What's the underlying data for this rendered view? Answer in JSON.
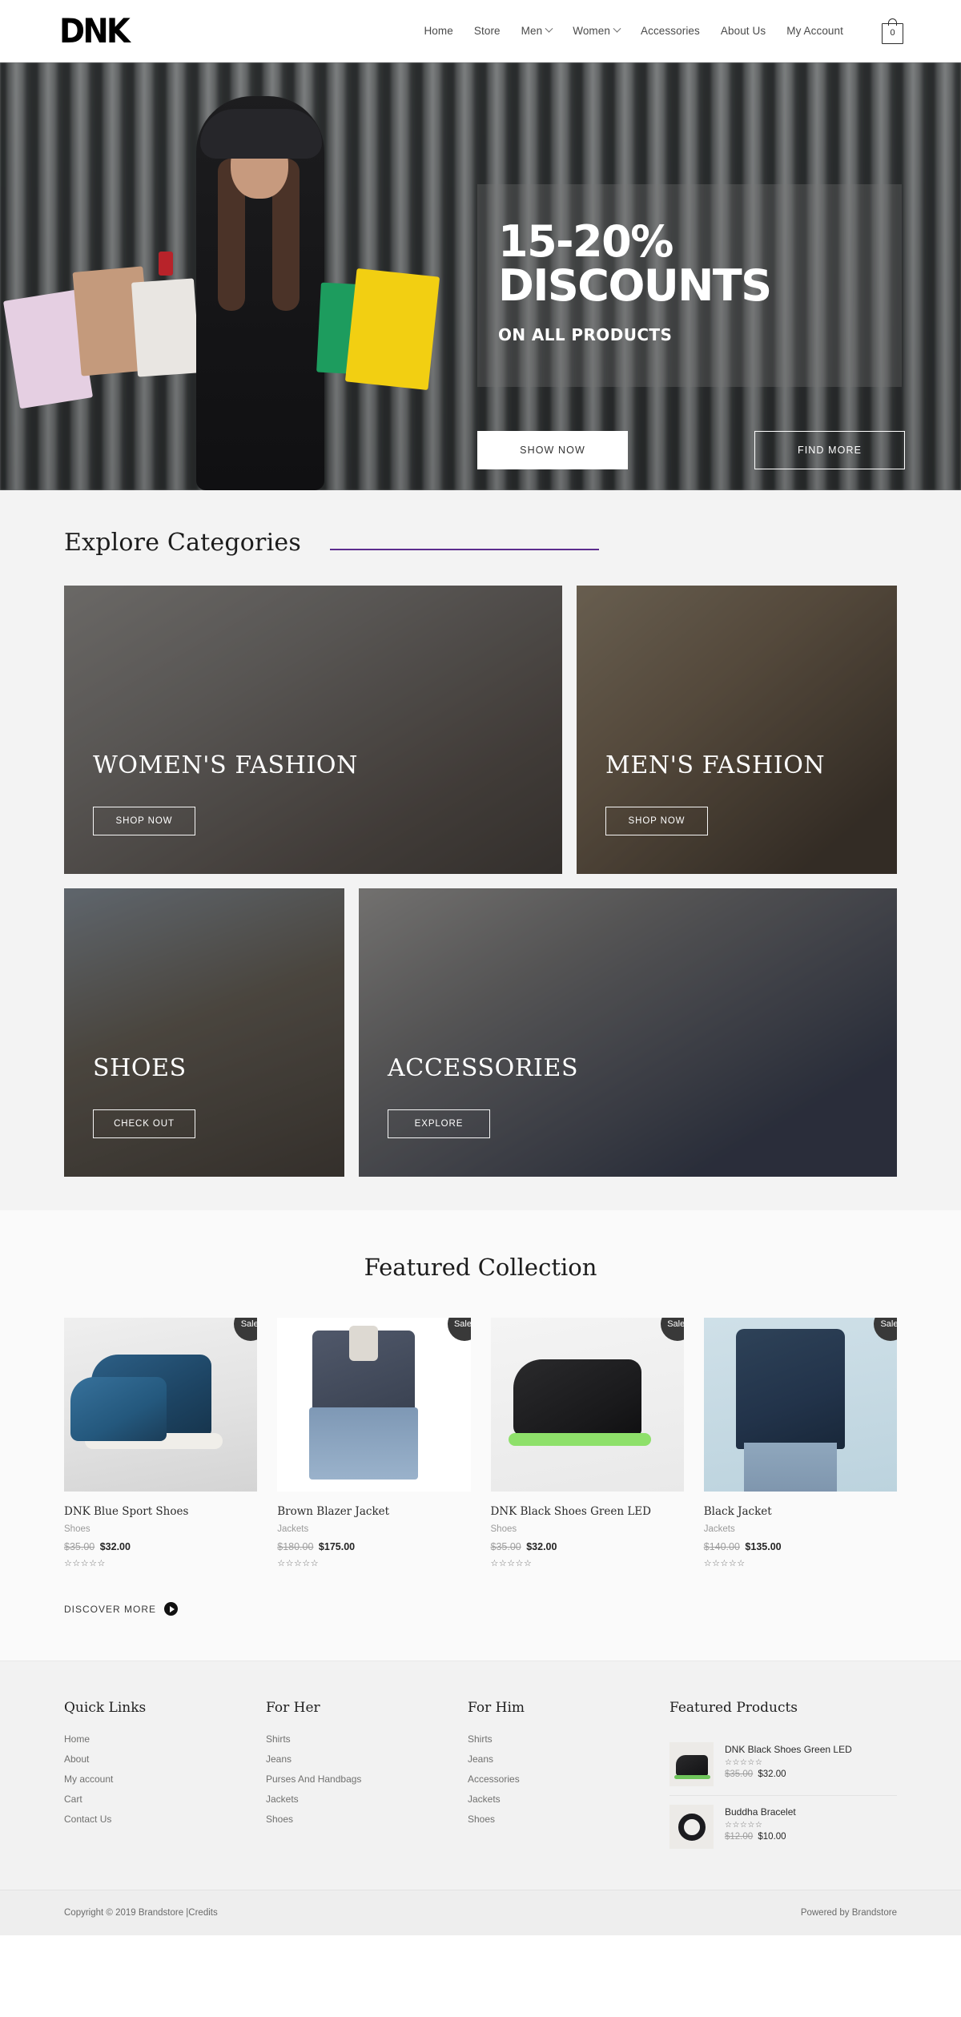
{
  "header": {
    "logo": "DNK",
    "nav": [
      {
        "label": "Home",
        "has_caret": false
      },
      {
        "label": "Store",
        "has_caret": false
      },
      {
        "label": "Men",
        "has_caret": true
      },
      {
        "label": "Women",
        "has_caret": true
      },
      {
        "label": "Accessories",
        "has_caret": false
      },
      {
        "label": "About Us",
        "has_caret": false
      },
      {
        "label": "My Account",
        "has_caret": false
      }
    ],
    "cart_count": "0"
  },
  "hero": {
    "headline_line1": "15-20%",
    "headline_line2": "DISCOUNTS",
    "subhead": "ON ALL PRODUCTS",
    "primary_button": "SHOW NOW",
    "secondary_button": "FIND MORE"
  },
  "categories": {
    "title": "Explore Categories",
    "accent_color": "#5b2c8d",
    "items": [
      {
        "label": "WOMEN'S FASHION",
        "button": "SHOP NOW"
      },
      {
        "label": "MEN'S FASHION",
        "button": "SHOP NOW"
      },
      {
        "label": "SHOES",
        "button": "CHECK OUT"
      },
      {
        "label": "ACCESSORIES",
        "button": "EXPLORE"
      }
    ]
  },
  "featured": {
    "title": "Featured Collection",
    "badge_label": "Sale!",
    "stars": "☆☆☆☆☆",
    "discover_label": "DISCOVER MORE",
    "products": [
      {
        "name": "DNK Blue Sport Shoes",
        "category": "Shoes",
        "old_price": "$35.00",
        "new_price": "$32.00"
      },
      {
        "name": "Brown Blazer Jacket",
        "category": "Jackets",
        "old_price": "$180.00",
        "new_price": "$175.00"
      },
      {
        "name": "DNK Black Shoes Green LED",
        "category": "Shoes",
        "old_price": "$35.00",
        "new_price": "$32.00"
      },
      {
        "name": "Black Jacket",
        "category": "Jackets",
        "old_price": "$140.00",
        "new_price": "$135.00"
      }
    ]
  },
  "footer": {
    "quick_links": {
      "title": "Quick Links",
      "items": [
        "Home",
        "About",
        "My account",
        "Cart",
        "Contact Us"
      ]
    },
    "for_her": {
      "title": "For Her",
      "items": [
        "Shirts",
        "Jeans",
        "Purses And Handbags",
        "Jackets",
        "Shoes"
      ]
    },
    "for_him": {
      "title": "For Him",
      "items": [
        "Shirts",
        "Jeans",
        "Accessories",
        "Jackets",
        "Shoes"
      ]
    },
    "featured_products": {
      "title": "Featured Products",
      "stars": "☆☆☆☆☆",
      "items": [
        {
          "name": "DNK Black Shoes Green LED",
          "old_price": "$35.00",
          "new_price": "$32.00"
        },
        {
          "name": "Buddha Bracelet",
          "old_price": "$12.00",
          "new_price": "$10.00"
        }
      ]
    }
  },
  "copyright": {
    "text": "Copyright © 2019 Brandstore | ",
    "credits": "Credits",
    "powered_by": "Powered by Brandstore"
  }
}
